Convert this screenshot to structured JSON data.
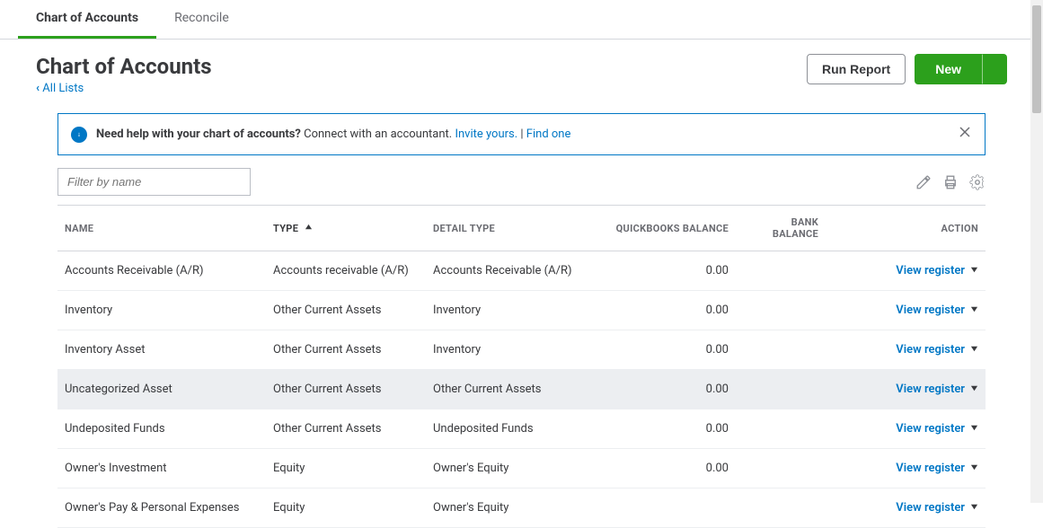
{
  "tabs": {
    "active": "Chart of Accounts",
    "secondary": "Reconcile"
  },
  "page_title": "Chart of Accounts",
  "back_link": "All Lists",
  "buttons": {
    "run_report": "Run Report",
    "new": "New"
  },
  "banner": {
    "bold": "Need help with your chart of accounts?",
    "plain": " Connect with an accountant. ",
    "invite": "Invite yours.",
    "sep": " | ",
    "find": "Find one"
  },
  "filter_placeholder": "Filter by name",
  "columns": {
    "name": "NAME",
    "type": "TYPE",
    "detail": "DETAIL TYPE",
    "qbal": "QUICKBOOKS BALANCE",
    "bbal": "BANK BALANCE",
    "action": "ACTION"
  },
  "action_label": "View register",
  "rows": [
    {
      "name": "Accounts Receivable (A/R)",
      "type": "Accounts receivable (A/R)",
      "detail": "Accounts Receivable (A/R)",
      "qbal": "0.00",
      "bbal": "",
      "selected": false
    },
    {
      "name": "Inventory",
      "type": "Other Current Assets",
      "detail": "Inventory",
      "qbal": "0.00",
      "bbal": "",
      "selected": false
    },
    {
      "name": "Inventory Asset",
      "type": "Other Current Assets",
      "detail": "Inventory",
      "qbal": "0.00",
      "bbal": "",
      "selected": false
    },
    {
      "name": "Uncategorized Asset",
      "type": "Other Current Assets",
      "detail": "Other Current Assets",
      "qbal": "0.00",
      "bbal": "",
      "selected": true
    },
    {
      "name": "Undeposited Funds",
      "type": "Other Current Assets",
      "detail": "Undeposited Funds",
      "qbal": "0.00",
      "bbal": "",
      "selected": false
    },
    {
      "name": "Owner's Investment",
      "type": "Equity",
      "detail": "Owner's Equity",
      "qbal": "0.00",
      "bbal": "",
      "selected": false
    },
    {
      "name": "Owner's Pay & Personal Expenses",
      "type": "Equity",
      "detail": "Owner's Equity",
      "qbal": "",
      "bbal": "",
      "selected": false
    }
  ]
}
